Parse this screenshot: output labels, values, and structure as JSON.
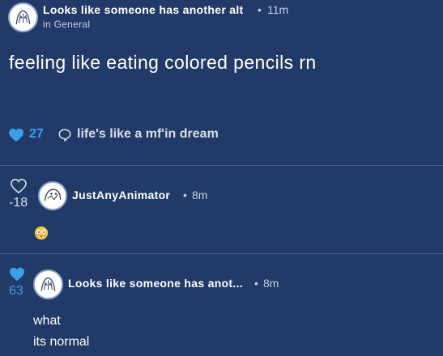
{
  "post": {
    "author": "Looks like someone has another alt",
    "time": "11m",
    "category": "in General",
    "body": "feeling like eating colored pencils rn",
    "likes": "27",
    "comment_preview": "life's like a mf'in dream",
    "like_color": "#3aa0ea"
  },
  "comments": [
    {
      "score": "-18",
      "author": "JustAnyAnimator",
      "time": "8m",
      "body": "😳",
      "liked": false
    },
    {
      "score": "63",
      "author": "Looks like someone has anot...",
      "time": "8m",
      "lines": [
        "what",
        "its normal"
      ],
      "liked": true
    }
  ],
  "icons": [
    "avatar-sketch-icon",
    "heart-filled-icon",
    "heart-outline-icon",
    "comment-bubble-icon",
    "flushed-face-emoji"
  ],
  "colors": {
    "background": "#223a68",
    "accent": "#3aa0ea",
    "divider": "#4a5f87"
  }
}
